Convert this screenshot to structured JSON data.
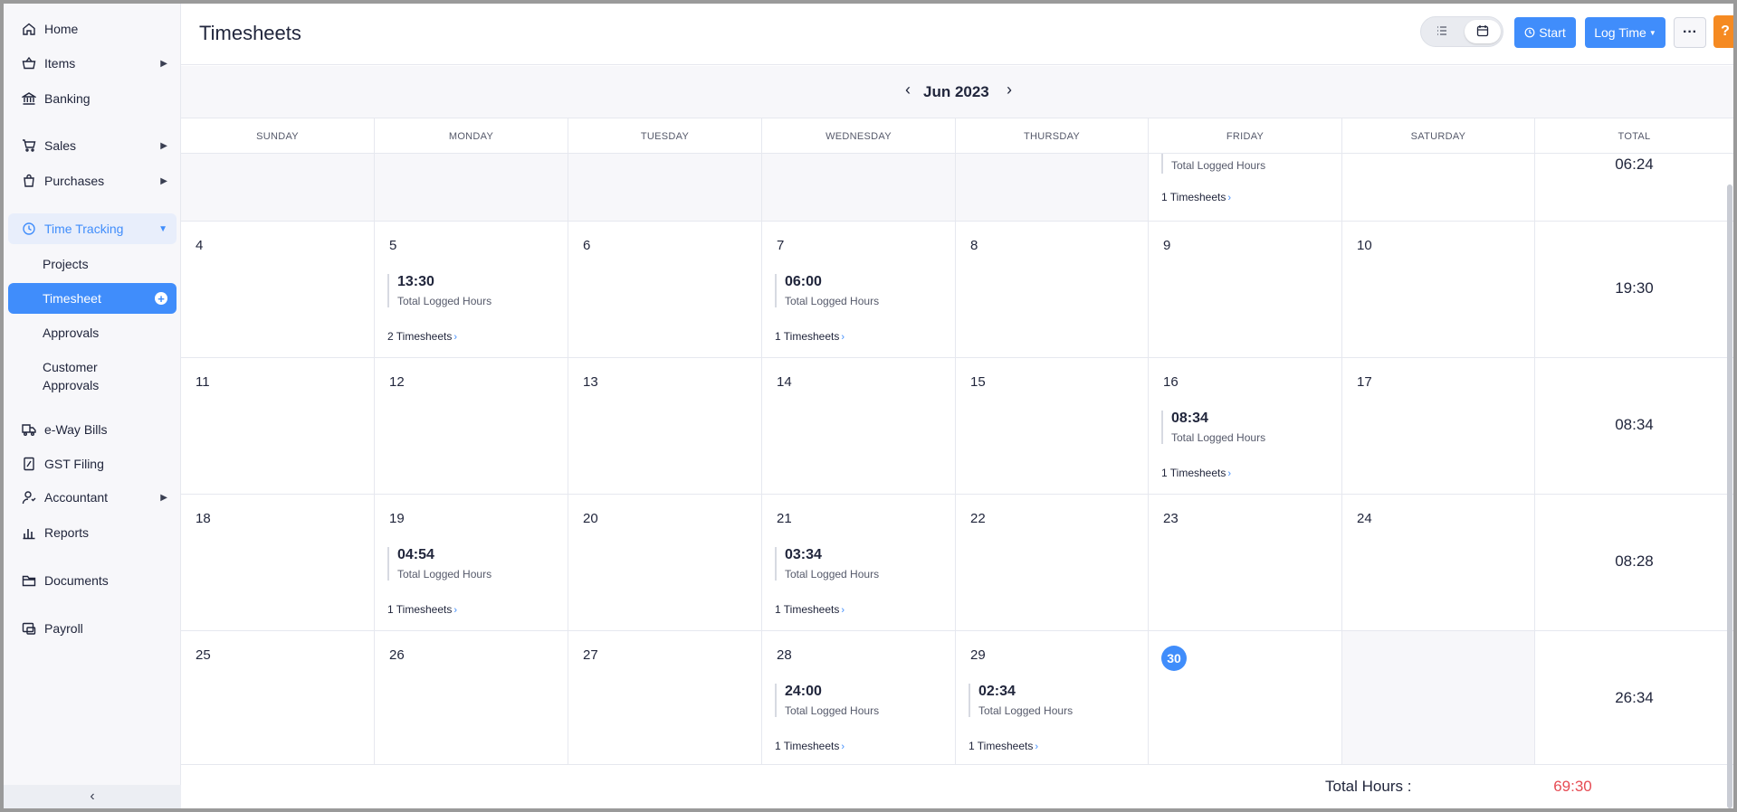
{
  "sidebar": {
    "items": [
      {
        "label": "Home",
        "icon": "home-icon"
      },
      {
        "label": "Items",
        "icon": "basket-icon"
      },
      {
        "label": "Banking",
        "icon": "bank-icon"
      },
      {
        "label": "Sales",
        "icon": "cart-icon"
      },
      {
        "label": "Purchases",
        "icon": "bag-icon"
      },
      {
        "label": "Time Tracking",
        "icon": "clock-icon"
      },
      {
        "label": "Projects"
      },
      {
        "label": "Timesheet"
      },
      {
        "label": "Approvals"
      },
      {
        "label": "Customer Approvals"
      },
      {
        "label": "e-Way Bills",
        "icon": "truck-icon"
      },
      {
        "label": "GST Filing",
        "icon": "gst-icon"
      },
      {
        "label": "Accountant",
        "icon": "accountant-icon"
      },
      {
        "label": "Reports",
        "icon": "reports-icon"
      },
      {
        "label": "Documents",
        "icon": "folder-icon"
      },
      {
        "label": "Payroll",
        "icon": "payroll-icon"
      }
    ],
    "customer_approvals_line1": "Customer",
    "customer_approvals_line2": "Approvals"
  },
  "header": {
    "title": "Timesheets",
    "start_label": "Start",
    "log_time_label": "Log Time",
    "more_label": "···",
    "help_label": "?"
  },
  "calendar": {
    "month_label": "Jun 2023",
    "days_of_week": [
      "SUNDAY",
      "MONDAY",
      "TUESDAY",
      "WEDNESDAY",
      "THURSDAY",
      "FRIDAY",
      "SATURDAY",
      "TOTAL"
    ],
    "entry_label": "Total Logged Hours",
    "first_week": {
      "friday_label": "Total Logged Hours",
      "friday_link": "1 Timesheets",
      "total": "06:24"
    },
    "weeks": [
      {
        "days": [
          "4",
          "5",
          "6",
          "7",
          "8",
          "9",
          "10"
        ],
        "entries": {
          "1": {
            "hours": "13:30",
            "link": "2 Timesheets"
          },
          "3": {
            "hours": "06:00",
            "link": "1 Timesheets"
          }
        },
        "total": "19:30"
      },
      {
        "days": [
          "11",
          "12",
          "13",
          "14",
          "15",
          "16",
          "17"
        ],
        "entries": {
          "5": {
            "hours": "08:34",
            "link": "1 Timesheets"
          }
        },
        "total": "08:34"
      },
      {
        "days": [
          "18",
          "19",
          "20",
          "21",
          "22",
          "23",
          "24"
        ],
        "entries": {
          "1": {
            "hours": "04:54",
            "link": "1 Timesheets"
          },
          "3": {
            "hours": "03:34",
            "link": "1 Timesheets"
          }
        },
        "total": "08:28"
      },
      {
        "days": [
          "25",
          "26",
          "27",
          "28",
          "29",
          "30",
          ""
        ],
        "entries": {
          "3": {
            "hours": "24:00",
            "link": "1 Timesheets"
          },
          "4": {
            "hours": "02:34",
            "link": "1 Timesheets"
          }
        },
        "today_index": 5,
        "total": "26:34"
      }
    ],
    "total_hours_label": "Total Hours :",
    "total_hours_value": "69:30"
  },
  "colors": {
    "accent": "#408dfb",
    "total_red": "#e64c54",
    "help_orange": "#f58a22"
  }
}
